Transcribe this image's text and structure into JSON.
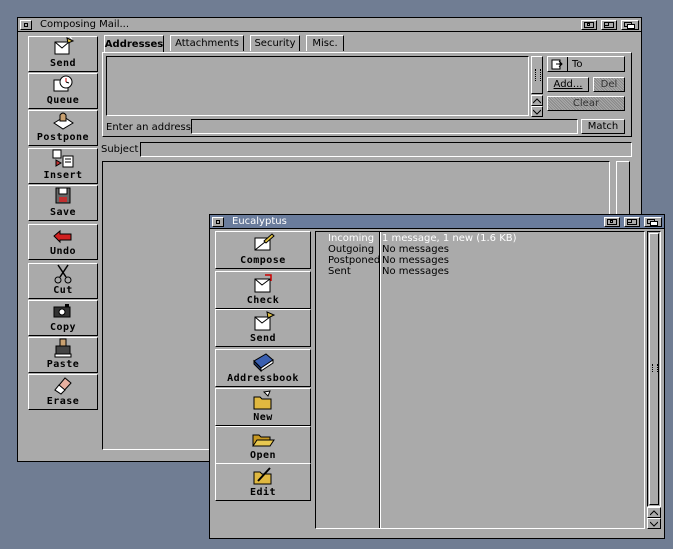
{
  "compose_window": {
    "title": "Composing Mail...",
    "toolbar": [
      {
        "name": "send",
        "label": "Send",
        "icon": "send-icon"
      },
      {
        "name": "queue",
        "label": "Queue",
        "icon": "clock-icon"
      },
      {
        "name": "postpone",
        "label": "Postpone",
        "icon": "postpone-icon"
      },
      {
        "name": "insert",
        "label": "Insert",
        "icon": "insert-icon"
      },
      {
        "name": "save",
        "label": "Save",
        "icon": "disk-icon"
      },
      {
        "name": "undo",
        "label": "Undo",
        "icon": "undo-arrow-icon"
      },
      {
        "name": "cut",
        "label": "Cut",
        "icon": "scissors-icon"
      },
      {
        "name": "copy",
        "label": "Copy",
        "icon": "copy-icon"
      },
      {
        "name": "paste",
        "label": "Paste",
        "icon": "paste-icon"
      },
      {
        "name": "erase",
        "label": "Erase",
        "icon": "eraser-icon"
      }
    ],
    "tabs": [
      {
        "label": "Addresses",
        "selected": true
      },
      {
        "label": "Attachments",
        "selected": false
      },
      {
        "label": "Security",
        "selected": false
      },
      {
        "label": "Misc.",
        "selected": false
      }
    ],
    "to_button": "To",
    "add_button": "Add...",
    "del_button": "Del",
    "clear_button": "Clear",
    "enter_address_label": "Enter an address",
    "address_value": "",
    "match_button": "Match",
    "subject_label": "Subject",
    "subject_value": ""
  },
  "main_window": {
    "title": "Eucalyptus",
    "toolbar": [
      {
        "name": "compose",
        "label": "Compose",
        "icon": "compose-icon"
      },
      {
        "name": "check",
        "label": "Check",
        "icon": "check-mail-icon"
      },
      {
        "name": "send",
        "label": "Send",
        "icon": "send-icon"
      },
      {
        "name": "addressbook",
        "label": "Addressbook",
        "icon": "addressbook-icon"
      },
      {
        "name": "new",
        "label": "New",
        "icon": "new-folder-icon"
      },
      {
        "name": "open",
        "label": "Open",
        "icon": "open-folder-icon"
      },
      {
        "name": "edit",
        "label": "Edit",
        "icon": "edit-folder-icon"
      }
    ],
    "folders": [
      {
        "name": "Incoming",
        "status": "1 message, 1 new (1.6 KB)"
      },
      {
        "name": "Outgoing",
        "status": "No messages"
      },
      {
        "name": "Postponed",
        "status": "No messages"
      },
      {
        "name": "Sent",
        "status": "No messages"
      }
    ]
  },
  "colors": {
    "desktop": "#707d93",
    "window_bg": "#aaaaaa",
    "active_title": "#6a7c9c"
  }
}
